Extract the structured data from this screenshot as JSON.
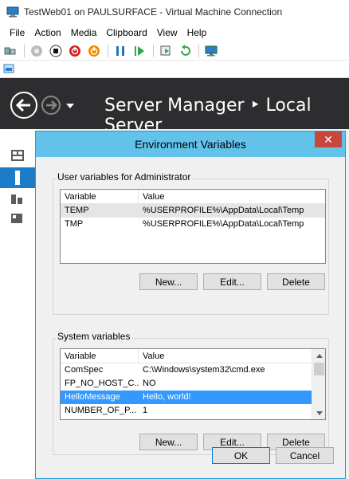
{
  "window": {
    "title": "TestWeb01 on PAULSURFACE - Virtual Machine Connection"
  },
  "menu": [
    "File",
    "Action",
    "Media",
    "Clipboard",
    "View",
    "Help"
  ],
  "toolbar": {
    "icons": [
      "ctrl-alt-del-icon",
      "start-icon",
      "turn-off-icon",
      "shutdown-icon",
      "power-icon",
      "pause-icon",
      "resume-icon",
      "checkpoint-icon",
      "revert-icon",
      "enhanced-session-icon"
    ]
  },
  "server_manager": {
    "title": "Server Manager ‣ Local Server"
  },
  "dialog": {
    "title": "Environment Variables",
    "close_glyph": "✕",
    "user_group_label": "User variables for Administrator",
    "system_group_label": "System variables",
    "column_variable": "Variable",
    "column_value": "Value",
    "user_vars": [
      {
        "name": "TEMP",
        "value": "%USERPROFILE%\\AppData\\Local\\Temp"
      },
      {
        "name": "TMP",
        "value": "%USERPROFILE%\\AppData\\Local\\Temp"
      }
    ],
    "system_vars": [
      {
        "name": "ComSpec",
        "value": "C:\\Windows\\system32\\cmd.exe"
      },
      {
        "name": "FP_NO_HOST_C...",
        "value": "NO"
      },
      {
        "name": "HelloMessage",
        "value": "Hello, world!"
      },
      {
        "name": "NUMBER_OF_P...",
        "value": "1"
      }
    ],
    "user_buttons": {
      "new": "New...",
      "edit": "Edit...",
      "delete": "Delete"
    },
    "system_buttons": {
      "new": "New...",
      "edit": "Edit...",
      "delete": "Delete"
    },
    "ok": "OK",
    "cancel": "Cancel"
  }
}
